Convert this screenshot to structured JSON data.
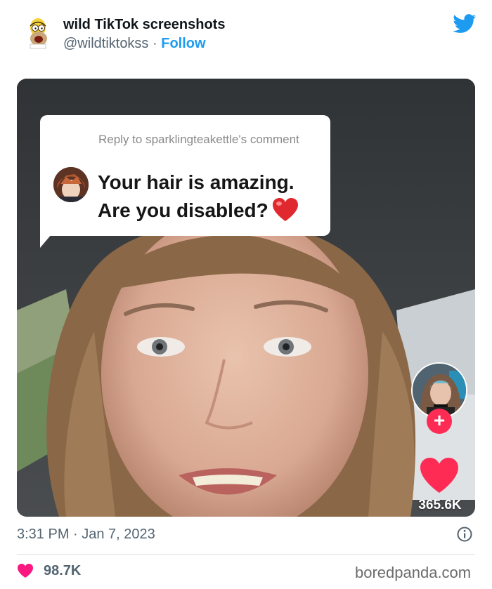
{
  "tweet": {
    "author_name": "wild TikTok screenshots",
    "handle": "@wildtiktokss",
    "separator": "·",
    "follow_label": "Follow",
    "avatar_icon": "homer-avatar-icon",
    "platform_icon": "twitter-bird-icon",
    "timestamp": "3:31 PM · Jan 7, 2023",
    "like_count": "98.7K",
    "like_icon": "heart-icon",
    "info_icon": "info-icon"
  },
  "tiktok": {
    "reply_to": "Reply to sparklingteakettle's comment",
    "comment_line1": "Your hair is amazing.",
    "comment_line2": "Are you disabled?",
    "comment_emoji": "red-heart-icon",
    "follow_plus": "+",
    "like_count": "365.6K"
  },
  "watermark": "boredpanda.com",
  "colors": {
    "twitter_blue": "#1d9bf0",
    "heart_pink": "#f91880",
    "tiktok_red": "#fe2c55",
    "text_gray": "#536471"
  }
}
